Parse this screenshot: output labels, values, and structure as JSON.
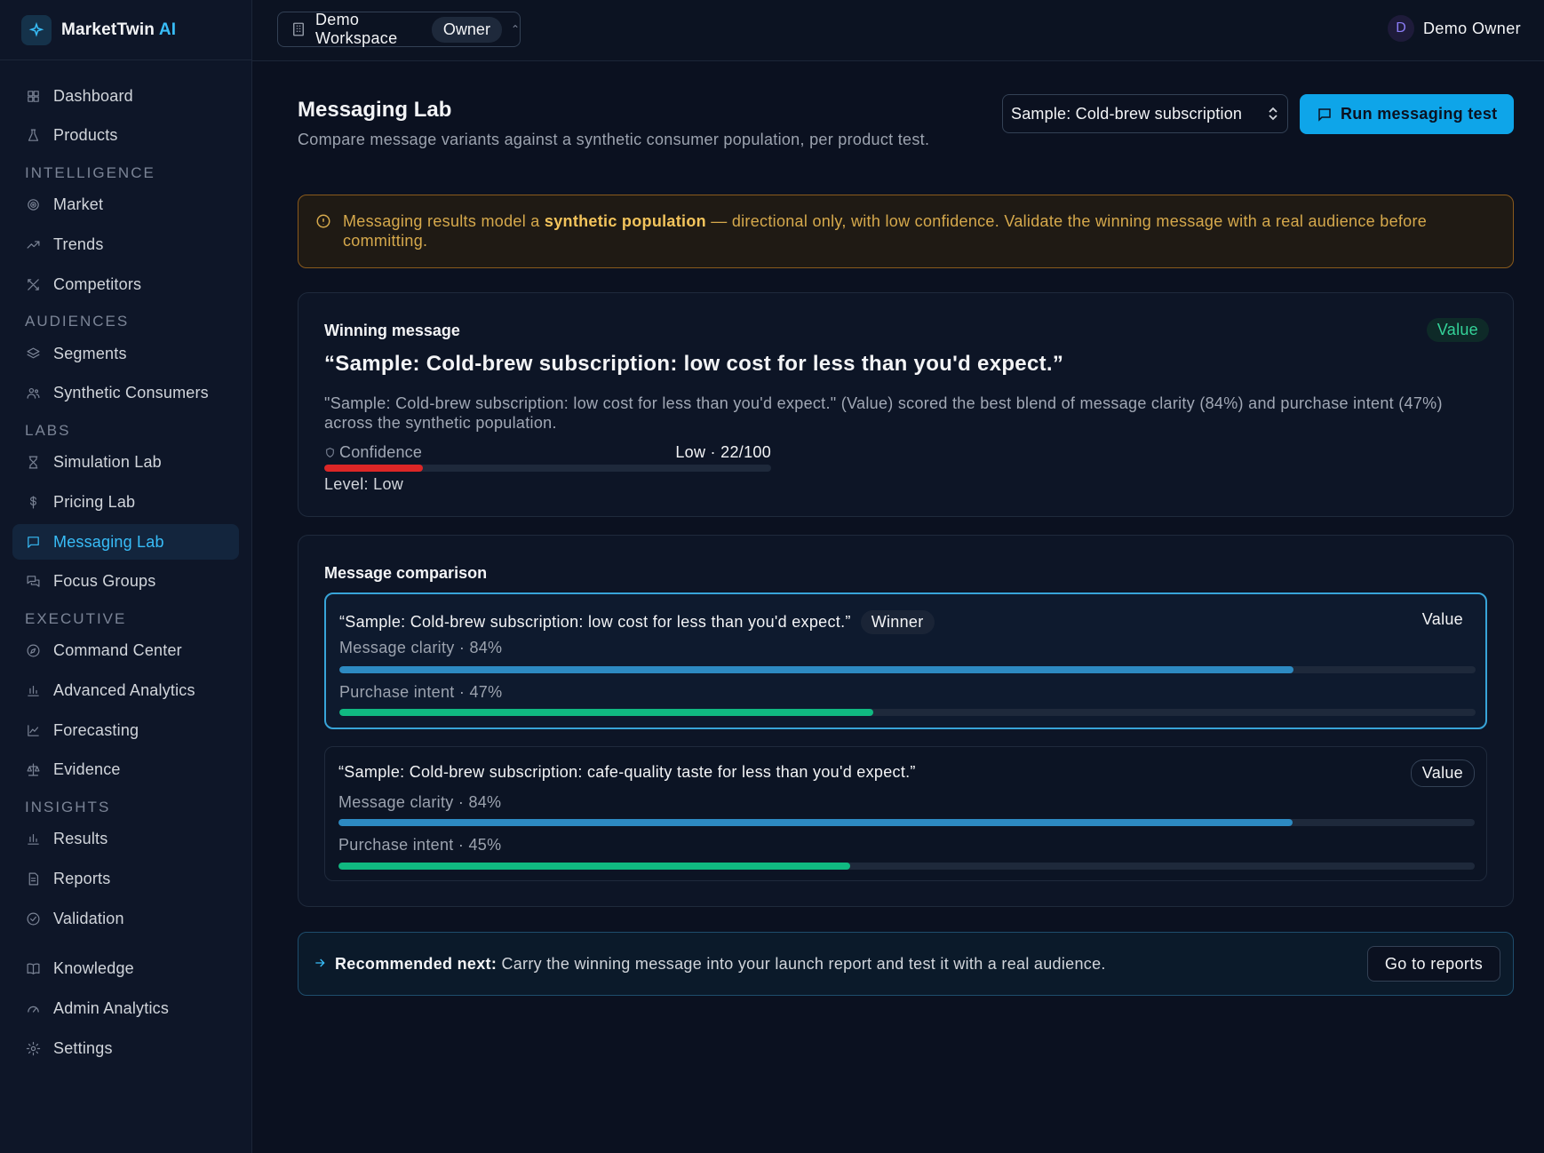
{
  "app": {
    "name": "MarketTwin",
    "name_suffix": "AI"
  },
  "topbar": {
    "workspace_name": "Demo Workspace",
    "workspace_role": "Owner",
    "user_initial": "D",
    "user_name": "Demo Owner"
  },
  "sidebar": {
    "top_items": [
      {
        "label": "Dashboard",
        "icon": "dashboard-icon"
      },
      {
        "label": "Products",
        "icon": "flask-icon"
      }
    ],
    "sections": [
      {
        "title": "INTELLIGENCE",
        "items": [
          {
            "label": "Market",
            "icon": "target-icon"
          },
          {
            "label": "Trends",
            "icon": "trend-up-icon"
          },
          {
            "label": "Competitors",
            "icon": "swords-icon"
          }
        ]
      },
      {
        "title": "AUDIENCES",
        "items": [
          {
            "label": "Segments",
            "icon": "layers-icon"
          },
          {
            "label": "Synthetic Consumers",
            "icon": "users-icon"
          }
        ]
      },
      {
        "title": "LABS",
        "items": [
          {
            "label": "Simulation Lab",
            "icon": "hourglass-icon"
          },
          {
            "label": "Pricing Lab",
            "icon": "dollar-icon"
          },
          {
            "label": "Messaging Lab",
            "icon": "message-icon",
            "active": true
          },
          {
            "label": "Focus Groups",
            "icon": "chat-icon"
          }
        ]
      },
      {
        "title": "EXECUTIVE",
        "items": [
          {
            "label": "Command Center",
            "icon": "compass-icon"
          },
          {
            "label": "Advanced Analytics",
            "icon": "bar-chart-icon"
          },
          {
            "label": "Forecasting",
            "icon": "line-chart-icon"
          },
          {
            "label": "Evidence",
            "icon": "scale-icon"
          }
        ]
      },
      {
        "title": "INSIGHTS",
        "items": [
          {
            "label": "Results",
            "icon": "bar-chart-icon"
          },
          {
            "label": "Reports",
            "icon": "file-icon"
          },
          {
            "label": "Validation",
            "icon": "check-circle-icon"
          }
        ]
      }
    ],
    "bottom_items": [
      {
        "label": "Knowledge",
        "icon": "book-icon"
      },
      {
        "label": "Admin Analytics",
        "icon": "gauge-icon"
      },
      {
        "label": "Settings",
        "icon": "gear-icon"
      }
    ]
  },
  "page": {
    "title": "Messaging Lab",
    "subtitle": "Compare message variants against a synthetic consumer population, per product test.",
    "sample_select_value": "Sample: Cold-brew subscription",
    "run_button": "Run messaging test"
  },
  "alert": {
    "text_before": "Messaging results model a ",
    "text_bold": "synthetic population",
    "text_after": " — directional only, with low confidence. Validate the winning message with a real audience before committing."
  },
  "winning": {
    "label": "Winning message",
    "tag": "Value",
    "quote": "“Sample: Cold-brew subscription: low cost for less than you'd expect.”",
    "description": "\"Sample: Cold-brew subscription: low cost for less than you'd expect.\" (Value) scored the best blend of message clarity (84%) and purchase intent (47%) across the synthetic population.",
    "confidence_label": "Confidence",
    "confidence_value": "Low · 22/100",
    "confidence_score": 22,
    "level": "Level: Low"
  },
  "comparison": {
    "title": "Message comparison",
    "variants": [
      {
        "quote": "“Sample: Cold-brew subscription: low cost for less than you'd expect.”",
        "winner_badge": "Winner",
        "tag": "Value",
        "clarity_label": "Message clarity · 84%",
        "clarity": 84,
        "intent_label": "Purchase intent · 47%",
        "intent": 47
      },
      {
        "quote": "“Sample: Cold-brew subscription: cafe-quality taste for less than you'd expect.”",
        "tag": "Value",
        "clarity_label": "Message clarity · 84%",
        "clarity": 84,
        "intent_label": "Purchase intent · 45%",
        "intent": 45
      }
    ]
  },
  "next": {
    "label": "Recommended next:",
    "text": " Carry the winning message into your launch report and test it with a real audience.",
    "button": "Go to reports"
  },
  "colors": {
    "accent": "#0ea5e9",
    "warning": "#d6a94c",
    "success": "#10b981",
    "danger": "#dc2626"
  }
}
